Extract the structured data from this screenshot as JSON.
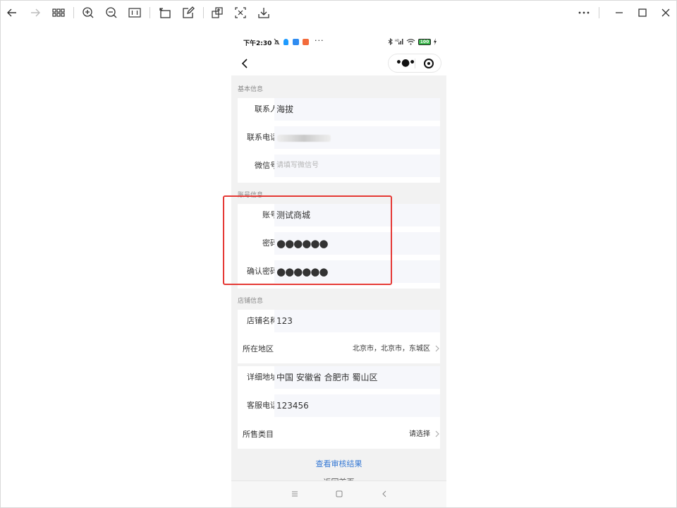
{
  "toolbar": {
    "buttons": [
      "back-arrow",
      "forward-arrow",
      "grid-view",
      "zoom-in",
      "zoom-out",
      "actual-size",
      "rotate",
      "edit",
      "crop",
      "screenshot",
      "download",
      "more",
      "minimize",
      "maximize",
      "close"
    ]
  },
  "status_bar": {
    "time": "下午2:30",
    "dots": "···",
    "battery": "100"
  },
  "sections": {
    "basic": "基本信息",
    "account": "账号信息",
    "shop": "店铺信息"
  },
  "basic": {
    "contact_label": "联系人",
    "contact_value": "海拔",
    "phone_label": "联系电话",
    "phone_value": "",
    "wechat_label": "微信号",
    "wechat_placeholder": "请填写微信号"
  },
  "account": {
    "account_label": "账号",
    "account_value": "测试商城",
    "password_label": "密码",
    "password_value": "●●●●●●",
    "confirm_label": "确认密码",
    "confirm_value": "●●●●●●"
  },
  "shop": {
    "name_label": "店铺名称",
    "name_value": "123",
    "region_label": "所在地区",
    "region_value": "北京市，北京市，东城区",
    "address_label": "详细地址",
    "address_value": "中国 安徽省 合肥市 蜀山区",
    "service_label": "客服电话",
    "service_value": "123456",
    "category_label": "所售类目",
    "category_value": "请选择"
  },
  "footer": {
    "review_link": "查看审核结果",
    "back_home": "返回首页"
  },
  "colors": {
    "accent_link": "#3478d4",
    "highlight": "#e53935"
  }
}
